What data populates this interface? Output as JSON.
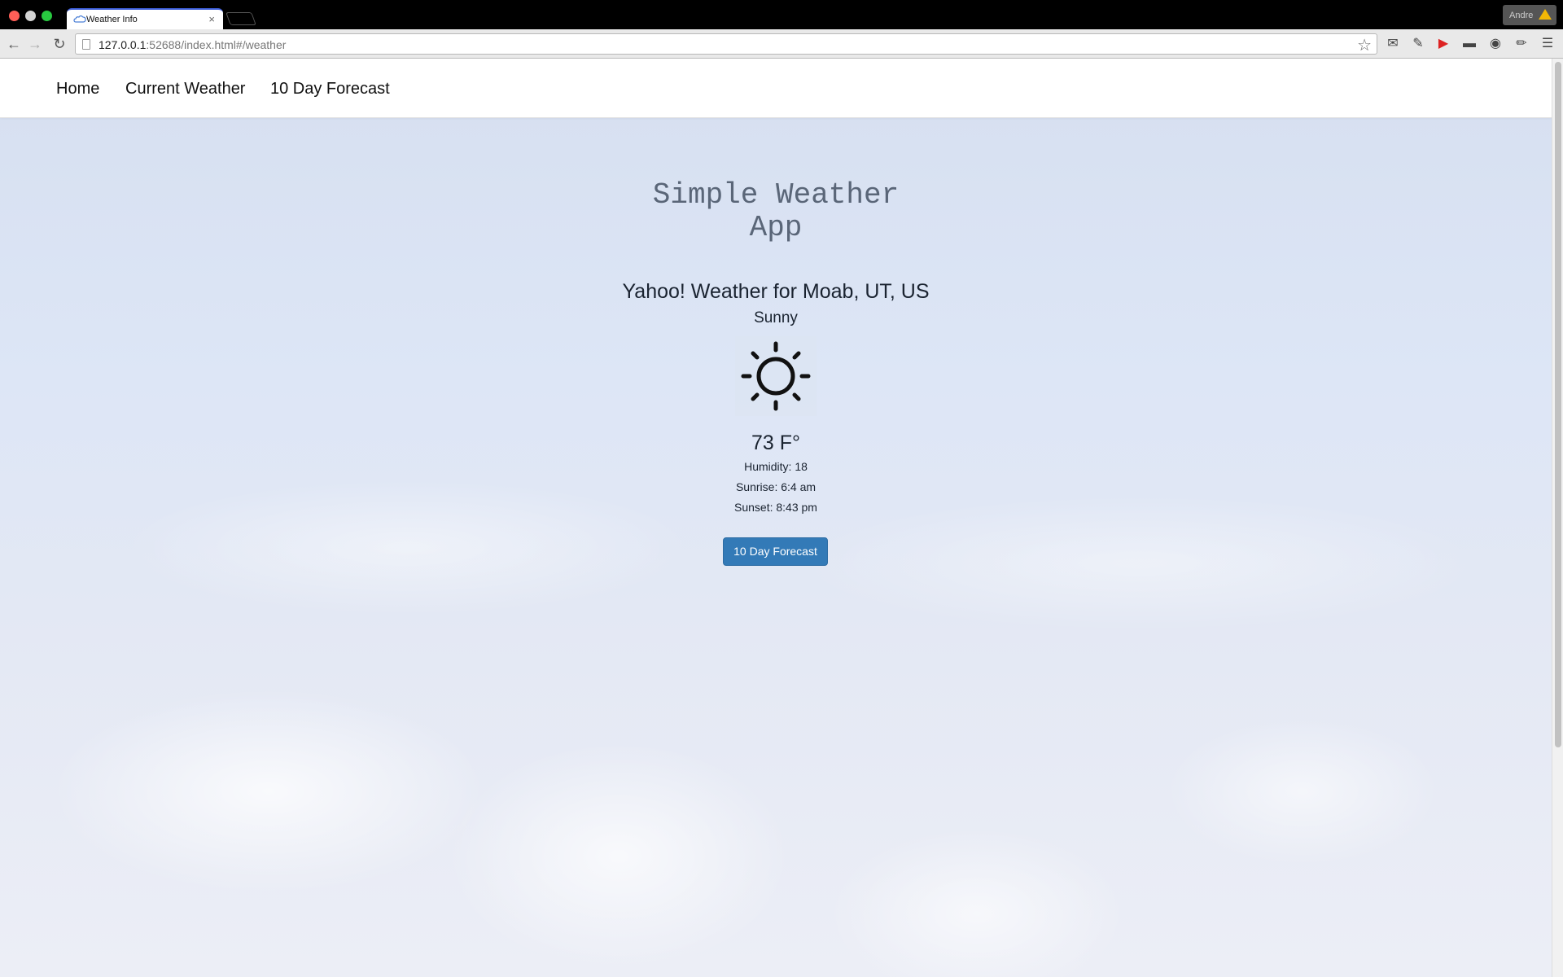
{
  "browser": {
    "tab_title": "Weather Info",
    "tab_close": "×",
    "url_host": "127.0.0.1",
    "url_rest": ":52688/index.html#/weather",
    "profile_name": "Andre"
  },
  "navbar": {
    "home": "Home",
    "current": "Current Weather",
    "forecast": "10 Day Forecast"
  },
  "main": {
    "title_line1": "Simple Weather",
    "title_line2": "App",
    "location": "Yahoo! Weather for Moab, UT, US",
    "condition": "Sunny",
    "condition_icon": "sun-icon",
    "temperature": "73 F°",
    "humidity": "Humidity: 18",
    "sunrise": "Sunrise: 6:4 am",
    "sunset": "Sunset: 8:43 pm",
    "forecast_button": "10 Day Forecast"
  },
  "colors": {
    "button": "#337ab7",
    "title": "#5a6678"
  }
}
